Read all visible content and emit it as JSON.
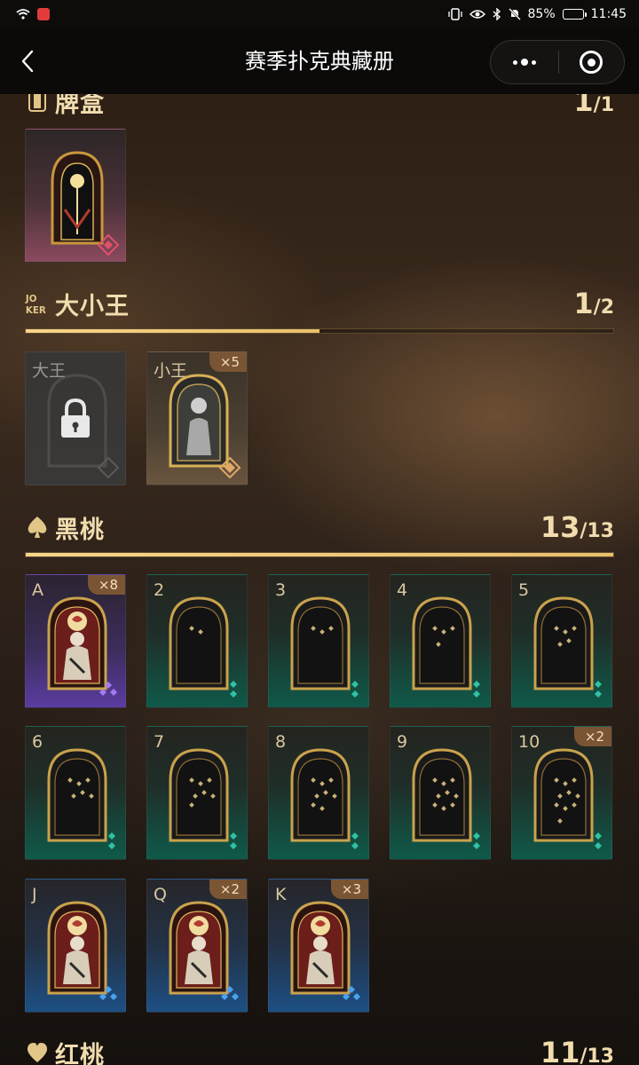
{
  "status_bar": {
    "battery_text": "85%",
    "battery_level": 0.85,
    "time": "11:45",
    "icons": [
      "wifi-icon",
      "app-notification-icon",
      "vibrate-icon",
      "eye-icon",
      "bluetooth-icon",
      "mute-icon",
      "battery-icon"
    ]
  },
  "nav": {
    "title": "赛季扑克典藏册",
    "back_icon": "chevron-left-icon",
    "more_icon": "more-dots-icon",
    "close_icon": "capsule-close-icon"
  },
  "sections": {
    "card_box": {
      "title": "牌盒",
      "count_current": "1",
      "count_total": "/1",
      "icon": "card-box-icon"
    },
    "jokers": {
      "title": "大小王",
      "count_current": "1",
      "count_total": "/2",
      "icon": "joker-icon",
      "progress": 0.5,
      "cards": [
        {
          "rank": "大王",
          "locked": true,
          "dup": ""
        },
        {
          "rank": "小王",
          "locked": false,
          "dup": "×5"
        }
      ]
    },
    "spades": {
      "title": "黑桃",
      "count_current": "13",
      "count_total": "/13",
      "icon": "spade-icon",
      "progress": 1.0,
      "cards": [
        {
          "rank": "A",
          "dup": "×8",
          "tone": "purple"
        },
        {
          "rank": "2",
          "dup": "",
          "tone": "teal"
        },
        {
          "rank": "3",
          "dup": "",
          "tone": "teal"
        },
        {
          "rank": "4",
          "dup": "",
          "tone": "teal"
        },
        {
          "rank": "5",
          "dup": "",
          "tone": "teal"
        },
        {
          "rank": "6",
          "dup": "",
          "tone": "teal"
        },
        {
          "rank": "7",
          "dup": "",
          "tone": "teal"
        },
        {
          "rank": "8",
          "dup": "",
          "tone": "teal"
        },
        {
          "rank": "9",
          "dup": "",
          "tone": "teal"
        },
        {
          "rank": "10",
          "dup": "×2",
          "tone": "teal"
        },
        {
          "rank": "J",
          "dup": "",
          "tone": "blue"
        },
        {
          "rank": "Q",
          "dup": "×2",
          "tone": "blue"
        },
        {
          "rank": "K",
          "dup": "×3",
          "tone": "blue"
        }
      ]
    },
    "hearts": {
      "title": "红桃",
      "count_current": "11",
      "count_total": "/13",
      "icon": "heart-icon"
    }
  },
  "colors": {
    "gold": "#f1dcae",
    "progress": "#f7d58c",
    "dup_badge": "#7a5534"
  }
}
